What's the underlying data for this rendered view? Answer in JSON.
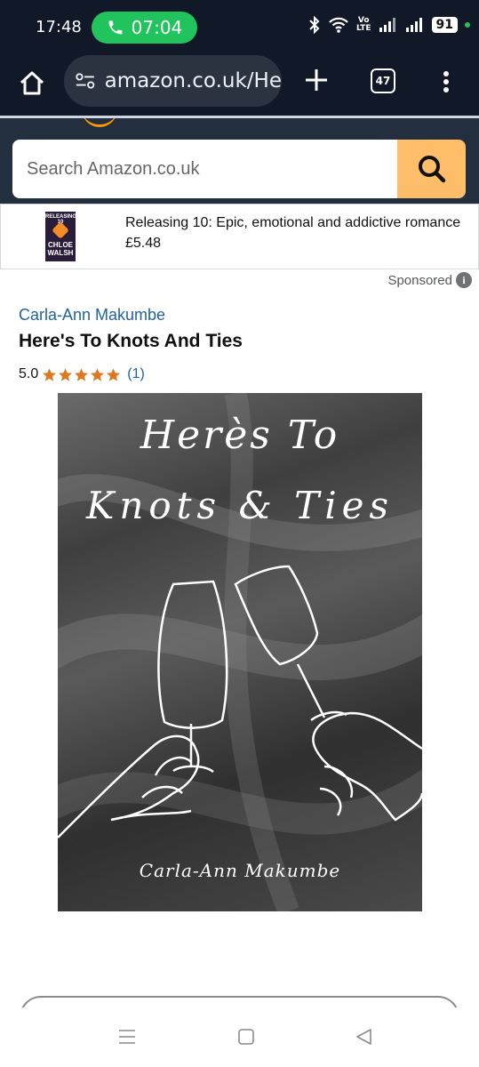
{
  "status_bar": {
    "time": "17:48",
    "call_timer": "07:04",
    "volte_top": "Vo",
    "volte_bottom": "LTE",
    "battery": "91",
    "icons": [
      "bluetooth-icon",
      "wifi-icon",
      "signal-icon",
      "battery-icon"
    ]
  },
  "browser": {
    "url": "amazon.co.uk/He",
    "tab_count": "47"
  },
  "search": {
    "placeholder": "Search Amazon.co.uk"
  },
  "ad": {
    "cover_top": "RELEASING 10",
    "cover_bottom": "CHLOE\nWALSH",
    "title": "Releasing 10: Epic, emotional and addictive romance",
    "price": "£5.48",
    "sponsored_label": "Sponsored"
  },
  "product": {
    "author": "Carla-Ann Makumbe",
    "title": "Here's To Knots And Ties",
    "rating": "5.0",
    "stars": 5,
    "review_count": "(1)"
  },
  "cover": {
    "line1": "Herès To",
    "line2": "Knots & Ties",
    "author": "Carla-Ann Makumbe"
  },
  "colors": {
    "status_bg": "#111827",
    "amazon_header": "#232f3e",
    "search_button": "#febd69",
    "link": "#2162a1",
    "star": "#f3a847",
    "call_green": "#21c35c"
  }
}
